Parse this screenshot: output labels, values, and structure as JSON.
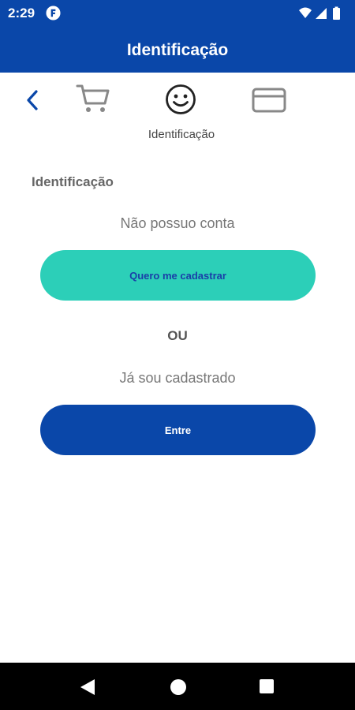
{
  "status_bar": {
    "time": "2:29",
    "icons": [
      "app-notification-icon",
      "wifi-icon",
      "signal-icon",
      "battery-icon"
    ]
  },
  "header": {
    "title": "Identificação"
  },
  "steps": {
    "icons": [
      "back-arrow-icon",
      "cart-icon",
      "smiley-icon",
      "credit-card-icon"
    ],
    "active_label": "Identificação"
  },
  "main": {
    "section_title": "Identificação",
    "no_account_text": "Não possuo conta",
    "register_button": "Quero me cadastrar",
    "or_text": "OU",
    "registered_text": "Já sou cadastrado",
    "login_button": "Entre"
  },
  "nav": {
    "icons": [
      "nav-back-icon",
      "nav-home-icon",
      "nav-recents-icon"
    ]
  },
  "colors": {
    "primary": "#0a47a9",
    "accent": "#2ccfb8",
    "register_text": "#1a3fa8"
  }
}
